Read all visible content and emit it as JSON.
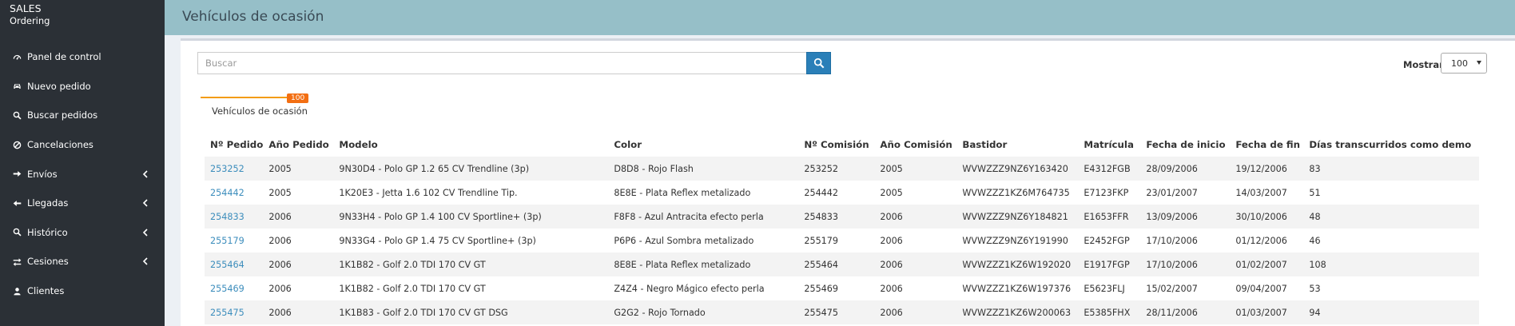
{
  "brand": {
    "line1": "SALES",
    "line2": "Ordering"
  },
  "sidebar": {
    "items": [
      {
        "label": "Panel de control",
        "icon": "dashboard-icon",
        "chevron": false
      },
      {
        "label": "Nuevo pedido",
        "icon": "car-icon",
        "chevron": false
      },
      {
        "label": "Buscar pedidos",
        "icon": "search-icon",
        "chevron": false
      },
      {
        "label": "Cancelaciones",
        "icon": "ban-icon",
        "chevron": false
      },
      {
        "label": "Envíos",
        "icon": "arrow-right-icon",
        "chevron": true
      },
      {
        "label": "Llegadas",
        "icon": "arrow-left-icon",
        "chevron": true
      },
      {
        "label": "Histórico",
        "icon": "search-icon",
        "chevron": true
      },
      {
        "label": "Cesiones",
        "icon": "exchange-icon",
        "chevron": true
      },
      {
        "label": "Clientes",
        "icon": "user-icon",
        "chevron": false
      }
    ]
  },
  "header": {
    "title": "Vehículos de ocasión"
  },
  "search": {
    "placeholder": "Buscar",
    "value": ""
  },
  "show": {
    "label": "Mostrar",
    "selected": "100"
  },
  "tab": {
    "label": "Vehículos de ocasión",
    "badge": "100"
  },
  "table": {
    "headers": [
      "Nº Pedido",
      "Año Pedido",
      "Modelo",
      "Color",
      "Nº Comisión",
      "Año Comisión",
      "Bastidor",
      "Matrícula",
      "Fecha de inicio",
      "Fecha de fin",
      "Días transcurridos como demo"
    ],
    "rows": [
      [
        "253252",
        "2005",
        "9N30D4 - Polo GP 1.2 65 CV Trendline (3p)",
        "D8D8 - Rojo Flash",
        "253252",
        "2005",
        "WVWZZZ9NZ6Y163420",
        "E4312FGB",
        "28/09/2006",
        "19/12/2006",
        "83"
      ],
      [
        "254442",
        "2005",
        "1K20E3 - Jetta 1.6 102 CV Trendline Tip.",
        "8E8E - Plata Reflex metalizado",
        "254442",
        "2005",
        "WVWZZZ1KZ6M764735",
        "E7123FKP",
        "23/01/2007",
        "14/03/2007",
        "51"
      ],
      [
        "254833",
        "2006",
        "9N33H4 - Polo GP 1.4 100 CV Sportline+ (3p)",
        "F8F8 - Azul Antracita efecto perla",
        "254833",
        "2006",
        "WVWZZZ9NZ6Y184821",
        "E1653FFR",
        "13/09/2006",
        "30/10/2006",
        "48"
      ],
      [
        "255179",
        "2006",
        "9N33G4 - Polo GP 1.4 75 CV Sportline+ (3p)",
        "P6P6 - Azul Sombra metalizado",
        "255179",
        "2006",
        "WVWZZZ9NZ6Y191990",
        "E2452FGP",
        "17/10/2006",
        "01/12/2006",
        "46"
      ],
      [
        "255464",
        "2006",
        "1K1B82 - Golf 2.0 TDI 170 CV GT",
        "8E8E - Plata Reflex metalizado",
        "255464",
        "2006",
        "WVWZZZ1KZ6W192020",
        "E1917FGP",
        "17/10/2006",
        "01/02/2007",
        "108"
      ],
      [
        "255469",
        "2006",
        "1K1B82 - Golf 2.0 TDI 170 CV GT",
        "Z4Z4 - Negro Mágico efecto perla",
        "255469",
        "2006",
        "WVWZZZ1KZ6W197376",
        "E5623FLJ",
        "15/02/2007",
        "09/04/2007",
        "53"
      ],
      [
        "255475",
        "2006",
        "1K1B83 - Golf 2.0 TDI 170 CV GT DSG",
        "G2G2 - Rojo Tornado",
        "255475",
        "2006",
        "WVWZZZ1KZ6W200063",
        "E5385FHX",
        "28/11/2006",
        "01/03/2007",
        "94"
      ]
    ]
  }
}
